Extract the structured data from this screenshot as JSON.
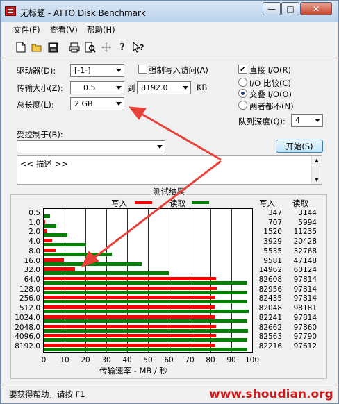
{
  "window": {
    "title": "无标题 - ATTO Disk Benchmark",
    "minimize": "—",
    "maximize": "□",
    "close": "✕"
  },
  "menu": [
    "文件(F)",
    "查看(V)",
    "帮助(H)"
  ],
  "toolbar_icons": [
    "new-file-icon",
    "open-folder-icon",
    "save-icon",
    "print-icon",
    "print-preview-icon",
    "move-icon",
    "help-icon",
    "context-help-icon"
  ],
  "controls": {
    "drive_label": "驱动器(D):",
    "drive_value": "[-1-]",
    "force_write_label": "强制写入访问(A)",
    "direct_io_label": "直接 I/O(R)",
    "direct_io_checked": "✔",
    "transfer_label": "传输大小(Z):",
    "transfer_from": "0.5",
    "transfer_to_word": "到",
    "transfer_to": "8192.0",
    "transfer_unit": "KB",
    "io_compare_label": "I/O 比较(C)",
    "overlap_io_label": "交叠 I/O(O)",
    "neither_label": "两者都不(N)",
    "total_label": "总长度(L):",
    "total_value": "2 GB",
    "queue_label": "队列深度(Q):",
    "queue_value": "4",
    "controlled_label": "受控制于(B):",
    "controlled_value": "",
    "start_button": "开始(S)",
    "description": "<< 描述 >>"
  },
  "results": {
    "title": "测试结果",
    "write_legend": "写入",
    "read_legend": "读取",
    "write_col": "写入",
    "read_col": "读取",
    "xlabel": "传输速率 - MB / 秒",
    "write_color": "#ff0000",
    "read_color": "#008000"
  },
  "chart_data": {
    "type": "bar",
    "title": "测试结果",
    "xlabel": "传输速率 - MB / 秒",
    "xlim": [
      0,
      100
    ],
    "xticks": [
      "0",
      "10",
      "20",
      "30",
      "40",
      "50",
      "60",
      "70",
      "80",
      "90",
      "100"
    ],
    "categories": [
      "0.5",
      "1.0",
      "2.0",
      "4.0",
      "8.0",
      "16.0",
      "32.0",
      "64.0",
      "128.0",
      "256.0",
      "512.0",
      "1024.0",
      "2048.0",
      "4096.0",
      "8192.0"
    ],
    "series": [
      {
        "name": "写入",
        "values": [
          0.347,
          0.707,
          1.52,
          3.929,
          5.535,
          9.581,
          14.962,
          82.608,
          82.956,
          82.435,
          82.048,
          82.241,
          82.662,
          82.563,
          82.216
        ]
      },
      {
        "name": "读取",
        "values": [
          3.144,
          5.994,
          11.235,
          20.428,
          32.768,
          47.148,
          60.124,
          97.814,
          97.814,
          97.814,
          98.181,
          97.814,
          97.86,
          97.79,
          97.612
        ]
      }
    ],
    "write_text": [
      "347",
      "707",
      "1520",
      "3929",
      "5535",
      "9581",
      "14962",
      "82608",
      "82956",
      "82435",
      "82048",
      "82241",
      "82662",
      "82563",
      "82216"
    ],
    "read_text": [
      "3144",
      "5994",
      "11235",
      "20428",
      "32768",
      "47148",
      "60124",
      "97814",
      "97814",
      "97814",
      "98181",
      "97814",
      "97860",
      "97790",
      "97612"
    ]
  },
  "status": {
    "text": "要获得帮助，请按 F1",
    "watermark": "www.shoudian.org"
  },
  "annotation_color": "#e8413a"
}
